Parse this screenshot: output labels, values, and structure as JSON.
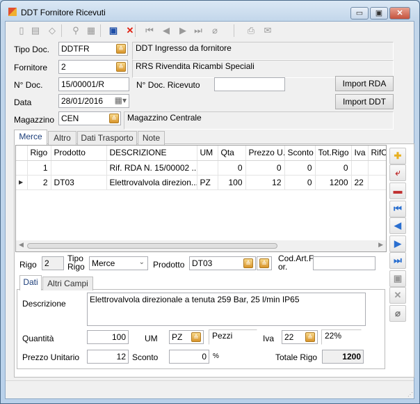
{
  "window": {
    "title": "DDT Fornitore Ricevuti",
    "min": "▭",
    "max": "▣",
    "close": "✕"
  },
  "toolbar": [
    {
      "icon": "new-icon",
      "g": "▯"
    },
    {
      "icon": "edit-icon",
      "g": "▤"
    },
    {
      "icon": "erase-icon",
      "g": "◇"
    },
    {
      "icon": "search-icon",
      "g": "⚲"
    },
    {
      "icon": "search-list-icon",
      "g": "▦"
    },
    {
      "icon": "save-icon",
      "g": "▣"
    },
    {
      "icon": "delete-icon",
      "g": "✕"
    },
    {
      "icon": "first-icon",
      "g": "⏮"
    },
    {
      "icon": "prev-icon",
      "g": "◀"
    },
    {
      "icon": "next-icon",
      "g": "▶"
    },
    {
      "icon": "last-icon",
      "g": "⏭"
    },
    {
      "icon": "attach-icon",
      "g": "⌀"
    },
    {
      "icon": "print-icon",
      "g": "⎙"
    },
    {
      "icon": "mail-icon",
      "g": "✉"
    }
  ],
  "header": {
    "tipo_doc": {
      "label": "Tipo Doc.",
      "value": "DDTFR",
      "desc": "DDT Ingresso da fornitore"
    },
    "fornitore": {
      "label": "Fornitore",
      "value": "2",
      "desc": "RRS Rivendita Ricambi Speciali"
    },
    "n_doc": {
      "label": "N° Doc.",
      "value": "15/00001/R"
    },
    "n_doc_ricevuto": {
      "label": "N° Doc. Ricevuto",
      "value": ""
    },
    "data": {
      "label": "Data",
      "value": "28/01/2016"
    },
    "magazzino": {
      "label": "Magazzino",
      "value": "CEN",
      "desc": "Magazzino Centrale"
    },
    "import_rda": "Import RDA",
    "import_ddt": "Import DDT"
  },
  "tabs": [
    "Merce",
    "Altro",
    "Dati Trasporto",
    "Note"
  ],
  "grid": {
    "columns": [
      "Rigo",
      "Prodotto",
      "DESCRIZIONE",
      "UM",
      "Qta",
      "Prezzo U.",
      "Sconto",
      "Tot.Rigo",
      "Iva",
      "RifOr"
    ],
    "rows": [
      [
        "1",
        "",
        "Rif. RDA N. 15/00002 ...",
        "",
        "0",
        "0",
        "0",
        "0",
        "",
        ""
      ],
      [
        "2",
        "DT03",
        "Elettrovalvola direzion...",
        "PZ",
        "100",
        "12",
        "0",
        "1200",
        "22",
        ""
      ]
    ],
    "selected_row": 2
  },
  "side_buttons": [
    {
      "icon": "add-icon",
      "g": "✚",
      "c": "#e8b020"
    },
    {
      "icon": "insert-icon",
      "g": "⤶",
      "c": "#c03030"
    },
    {
      "icon": "remove-icon",
      "g": "▬",
      "c": "#c03030"
    },
    {
      "icon": "first-icon",
      "g": "⏮",
      "c": "#2a6fd0"
    },
    {
      "icon": "prev-icon",
      "g": "◀",
      "c": "#2a6fd0"
    },
    {
      "icon": "next-icon",
      "g": "▶",
      "c": "#2a6fd0"
    },
    {
      "icon": "last-icon",
      "g": "⏭",
      "c": "#2a6fd0"
    },
    {
      "icon": "save-icon",
      "g": "▣",
      "c": "#999"
    },
    {
      "icon": "cancel-icon",
      "g": "✕",
      "c": "#999"
    },
    {
      "icon": "attach-icon",
      "g": "⌀",
      "c": "#777"
    }
  ],
  "detail": {
    "rigo": {
      "label": "Rigo",
      "value": "2"
    },
    "tipo_rigo": {
      "label1": "Tipo",
      "label2": "Rigo",
      "value": "Merce"
    },
    "prodotto": {
      "label": "Prodotto",
      "value": "DT03"
    },
    "cod_art": {
      "label1": "Cod.Art.F",
      "label2": "or.",
      "value": ""
    },
    "tabs": [
      "Dati",
      "Altri Campi"
    ],
    "descrizione": {
      "label": "Descrizione",
      "value": "Elettrovalvola direzionale a tenuta  259 Bar, 25 l/min IP65"
    },
    "quantita": {
      "label": "Quantità",
      "value": "100"
    },
    "um": {
      "label": "UM",
      "value": "PZ",
      "desc": "Pezzi"
    },
    "iva": {
      "label": "Iva",
      "value": "22",
      "desc": "22%"
    },
    "prezzo": {
      "label": "Prezzo Unitario",
      "value": "12"
    },
    "sconto": {
      "label": "Sconto",
      "value": "0",
      "unit": "%"
    },
    "totale": {
      "label": "Totale Rigo",
      "value": "1200"
    }
  }
}
